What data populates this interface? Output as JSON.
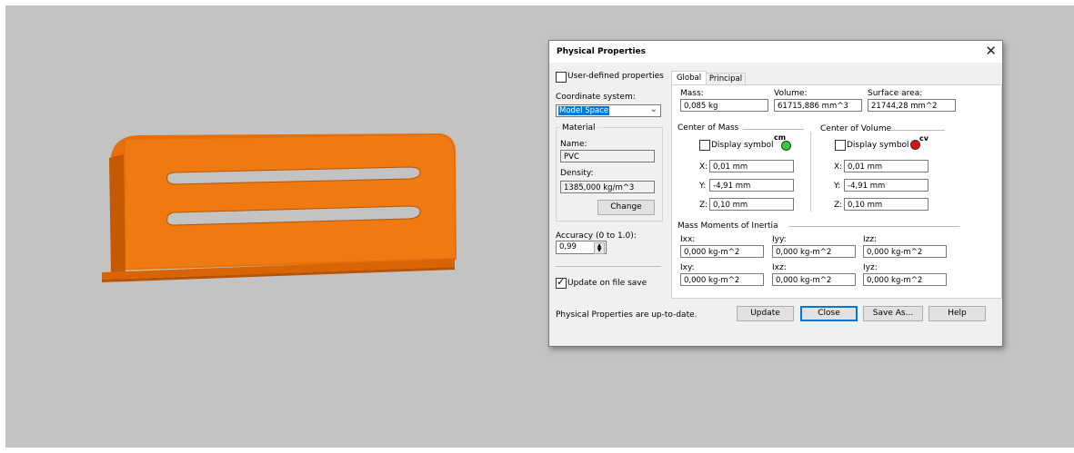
{
  "dialog": {
    "title": "Physical Properties",
    "close_glyph": "✕",
    "user_defined_label": "User-defined properties",
    "coordinate_system_label": "Coordinate system:",
    "coordinate_system_value": "Model Space",
    "material_group_label": "Material",
    "material_name_label": "Name:",
    "material_name_value": "PVC",
    "density_label": "Density:",
    "density_value": "1385,000 kg/m^3",
    "change_button": "Change",
    "accuracy_label": "Accuracy (0 to 1.0):",
    "accuracy_value": "0,99",
    "update_on_save_label": "Update on file save",
    "update_on_save_checked": true,
    "status_text": "Physical Properties are up-to-date.",
    "buttons": {
      "update": "Update",
      "close": "Close",
      "save_as": "Save As...",
      "help": "Help"
    }
  },
  "tabs": [
    {
      "label": "Global",
      "active": true
    },
    {
      "label": "Principal",
      "active": false
    }
  ],
  "global": {
    "mass_label": "Mass:",
    "mass_value": "0,085 kg",
    "volume_label": "Volume:",
    "volume_value": "61715,886 mm^3",
    "surface_area_label": "Surface area:",
    "surface_area_value": "21744,28 mm^2",
    "center_of_mass": {
      "label": "Center of Mass",
      "display_symbol_label": "Display symbol",
      "symbol_text": "cm",
      "symbol_color": "#2ecc40",
      "x_label": "X:",
      "x_value": "0,01 mm",
      "y_label": "Y:",
      "y_value": "-4,91 mm",
      "z_label": "Z:",
      "z_value": "0,10 mm"
    },
    "center_of_volume": {
      "label": "Center of Volume",
      "display_symbol_label": "Display symbol",
      "symbol_text": "cv",
      "symbol_color": "#e01010",
      "x_label": "X:",
      "x_value": "0,01 mm",
      "y_label": "Y:",
      "y_value": "-4,91 mm",
      "z_label": "Z:",
      "z_value": "0,10 mm"
    },
    "inertia": {
      "label": "Mass Moments of Inertia",
      "ixx_label": "Ixx:",
      "ixx_value": "0,000 kg-m^2",
      "iyy_label": "Iyy:",
      "iyy_value": "0,000 kg-m^2",
      "izz_label": "Izz:",
      "izz_value": "0,000 kg-m^2",
      "ixy_label": "Ixy:",
      "ixy_value": "0,000 kg-m^2",
      "ixz_label": "Ixz:",
      "ixz_value": "0,000 kg-m^2",
      "iyz_label": "Iyz:",
      "iyz_value": "0,000 kg-m^2"
    }
  },
  "colors": {
    "viewport_bg": "#c3c3c3",
    "part_orange": "#f07a12",
    "selection_blue": "#0078d7"
  }
}
